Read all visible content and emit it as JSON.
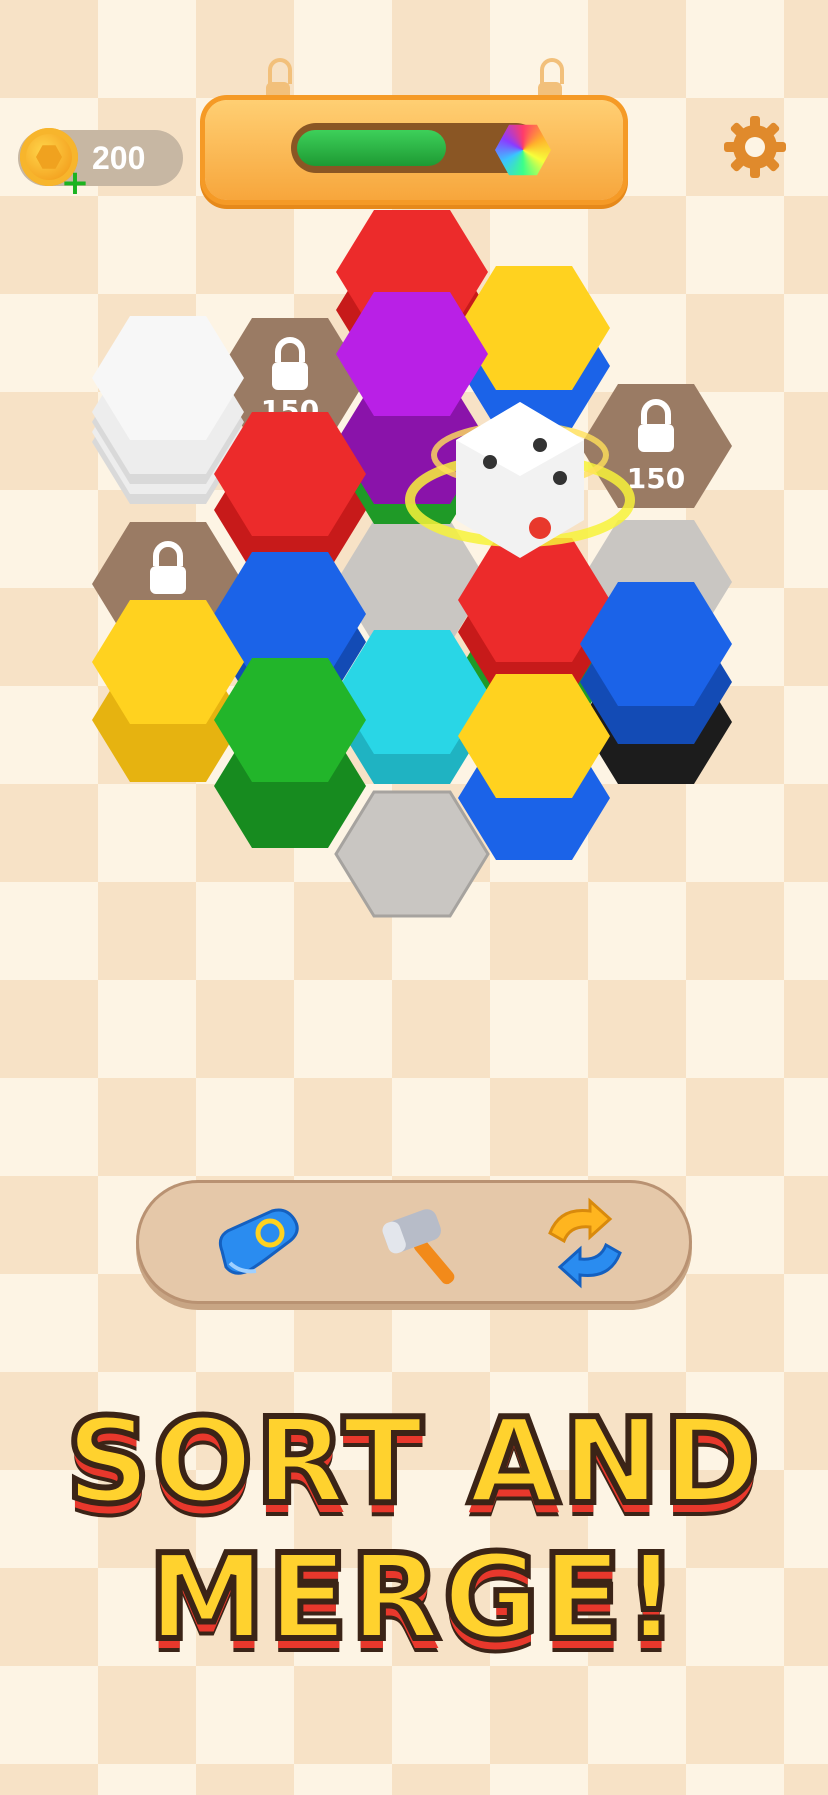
{
  "hud": {
    "coins": "200",
    "level_progress": 0.62,
    "icons": [
      "coin-icon",
      "add-coins-icon",
      "rainbow-gem-icon",
      "gear-icon"
    ]
  },
  "board": {
    "locked_tiles": [
      {
        "label": "150"
      },
      {
        "label": "150"
      },
      {
        "label": ""
      }
    ],
    "stacks": [
      {
        "top_color": "#f4f4f4",
        "layers": [
          "#ffffff"
        ]
      },
      {
        "top_color": "#e82424",
        "layers": [
          "#e82424"
        ]
      },
      {
        "top_color": "#ffd21f",
        "layers": [
          "#1b63e8"
        ]
      },
      {
        "top_color": "#b920e6",
        "layers": [
          "#22b52a"
        ]
      },
      {
        "top_color": "#1b63e8",
        "layers": [
          "#1b63e8"
        ]
      },
      {
        "top_color": "#ffd21f",
        "layers": [
          "#ffd21f"
        ]
      },
      {
        "top_color": "#22b52a",
        "layers": [
          "#22b52a"
        ]
      },
      {
        "top_color": "#29d6e6",
        "layers": [
          "#29d6e6"
        ]
      },
      {
        "top_color": "#ffd21f",
        "layers": [
          "#1b63e8"
        ]
      },
      {
        "top_color": "#1b63e8",
        "layers": [
          "#222222"
        ]
      }
    ],
    "effect": "dice-spin-icon"
  },
  "tools": [
    {
      "name": "swap-glove",
      "icon": "glove-swap-icon"
    },
    {
      "name": "hammer",
      "icon": "hammer-icon"
    },
    {
      "name": "shuffle",
      "icon": "shuffle-arrows-icon"
    }
  ],
  "headline": {
    "line1": "SORT AND",
    "line2": "MERGE!"
  },
  "colors": {
    "accent_orange": "#f59a26",
    "headline_yellow": "#ffd22e",
    "headline_red": "#e8382c"
  }
}
